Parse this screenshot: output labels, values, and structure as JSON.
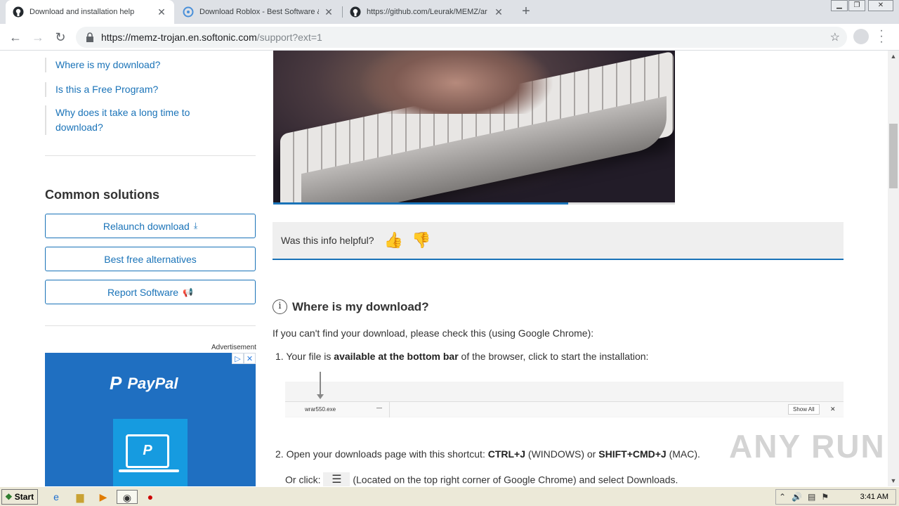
{
  "browser": {
    "tabs": [
      {
        "title": "Download and installation help",
        "icon": "github-icon",
        "active": true
      },
      {
        "title": "Download Roblox - Best Software &",
        "icon": "softonic-icon",
        "active": false
      },
      {
        "title": "https://github.com/Leurak/MEMZ/ar",
        "icon": "github-icon",
        "active": false
      }
    ],
    "new_tab": "+",
    "window_controls": {
      "minimize": "▁",
      "restore": "❐",
      "close": "✕"
    },
    "url_main": "https://memz-trojan.en.softonic.com",
    "url_path": "/support?ext=1"
  },
  "sidebar": {
    "links": [
      "Where is my download?",
      "Is this a Free Program?",
      "Why does it take a long time to download?"
    ],
    "common_title": "Common solutions",
    "buttons": {
      "relaunch": "Relaunch download",
      "alternatives": "Best free alternatives",
      "report": "Report Software"
    },
    "ad_label": "Advertisement",
    "ad_brand": "PayPal",
    "ad_choices": [
      "▷",
      "✕"
    ]
  },
  "main": {
    "helpful_question": "Was this info helpful?",
    "section_title": "Where is my download?",
    "intro": "If you can't find your download, please check this (using Google Chrome):",
    "step1_prefix": "1. Your file is ",
    "step1_bold": "available at the bottom bar",
    "step1_suffix": " of the browser, click to start the installation:",
    "shot_file": "wrar550.exe",
    "shot_showall": "Show All",
    "step2_prefix": "2. Open your downloads page with this shortcut: ",
    "step2_key1": "CTRL+J",
    "step2_mid": " (WINDOWS) or ",
    "step2_key2": "SHIFT+CMD+J",
    "step2_suffix": " (MAC).",
    "step3_prefix": "Or click: ",
    "step3_suffix": " (Located on the top right corner of Google Chrome) and select Downloads."
  },
  "watermark": "ANY RUN",
  "taskbar": {
    "start": "Start",
    "clock": "3:41 AM"
  },
  "colors": {
    "accent": "#1a73b8"
  }
}
